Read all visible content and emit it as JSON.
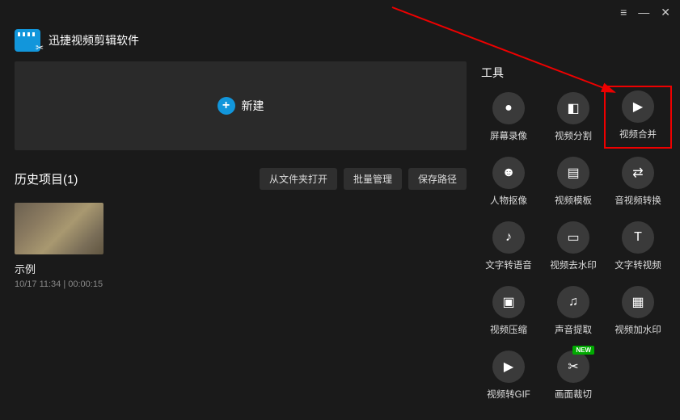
{
  "app": {
    "title": "迅捷视频剪辑软件"
  },
  "titlebar": {
    "menu": "≡",
    "min": "—",
    "close": "✕"
  },
  "newArea": {
    "label": "新建"
  },
  "history": {
    "title": "历史项目(1)",
    "buttons": {
      "openFolder": "从文件夹打开",
      "batch": "批量管理",
      "savePath": "保存路径"
    },
    "project": {
      "name": "示例",
      "meta": "10/17 11:34 | 00:00:15"
    }
  },
  "tools": {
    "header": "工具",
    "items": [
      {
        "label": "屏幕录像",
        "icon": "●"
      },
      {
        "label": "视频分割",
        "icon": "◧"
      },
      {
        "label": "视频合并",
        "icon": "▶"
      },
      {
        "label": "人物抠像",
        "icon": "☻"
      },
      {
        "label": "视频模板",
        "icon": "▤"
      },
      {
        "label": "音视频转换",
        "icon": "⇄"
      },
      {
        "label": "文字转语音",
        "icon": "♪"
      },
      {
        "label": "视频去水印",
        "icon": "▭"
      },
      {
        "label": "文字转视频",
        "icon": "T"
      },
      {
        "label": "视频压缩",
        "icon": "▣"
      },
      {
        "label": "声音提取",
        "icon": "♫"
      },
      {
        "label": "视频加水印",
        "icon": "▦"
      },
      {
        "label": "视频转GIF",
        "icon": "▶"
      },
      {
        "label": "画面裁切",
        "icon": "✂",
        "badge": "NEW"
      }
    ]
  },
  "highlightedToolIndex": 2
}
